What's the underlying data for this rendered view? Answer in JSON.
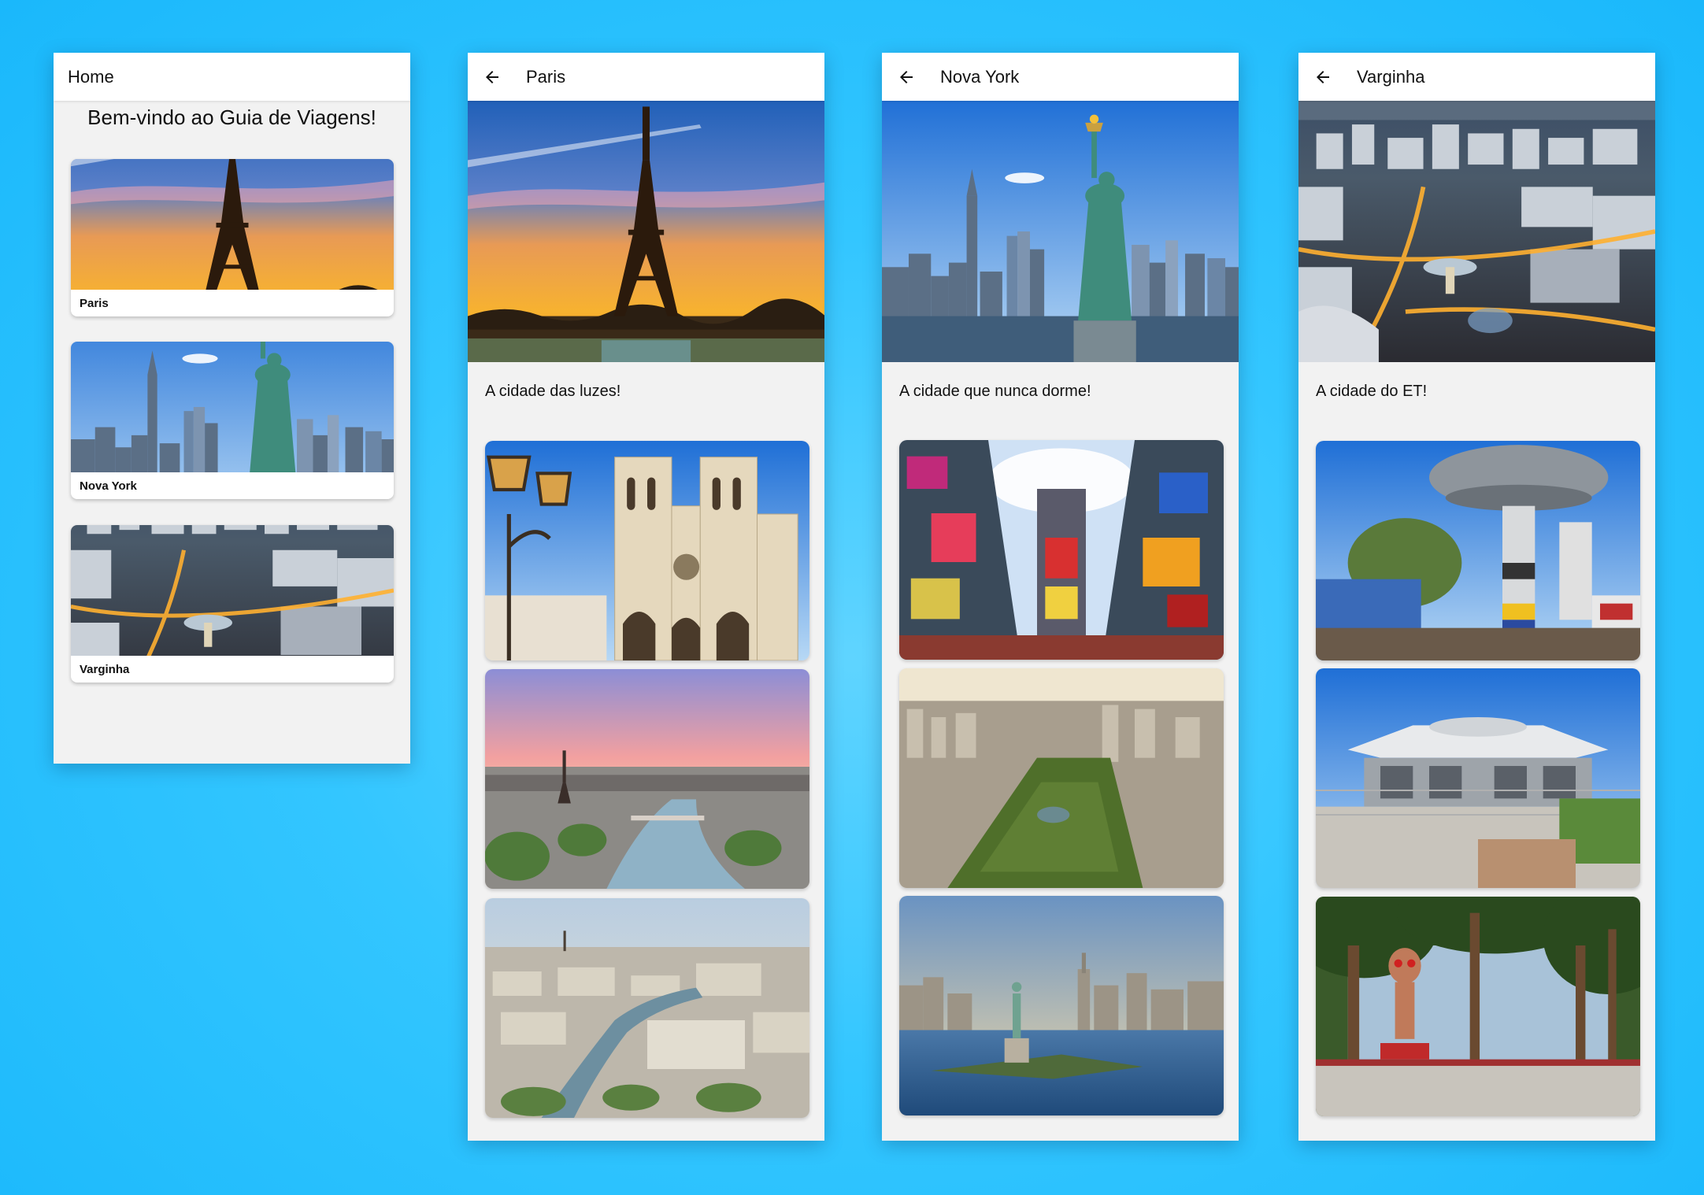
{
  "screens": {
    "home": {
      "title": "Home",
      "welcome": "Bem-vindo ao Guia de Viagens!",
      "cards": [
        {
          "label": "Paris",
          "image": "eiffel-tower-sunset"
        },
        {
          "label": "Nova York",
          "image": "statue-of-liberty-skyline"
        },
        {
          "label": "Varginha",
          "image": "varginha-aerial-night"
        }
      ]
    },
    "paris": {
      "title": "Paris",
      "description": "A cidade das luzes!",
      "hero": "eiffel-tower-sunset",
      "gallery": [
        "notre-dame-cathedral",
        "seine-river-sunset",
        "paris-aerial-view"
      ]
    },
    "nova_york": {
      "title": "Nova York",
      "description": "A cidade que nunca dorme!",
      "hero": "statue-of-liberty-skyline",
      "gallery": [
        "times-square",
        "central-park-aerial",
        "liberty-island-harbor"
      ]
    },
    "varginha": {
      "title": "Varginha",
      "description": "A cidade do ET!",
      "hero": "varginha-aerial-night",
      "gallery": [
        "ufo-water-tower",
        "ufo-shaped-building",
        "alien-statue-park"
      ]
    }
  },
  "icons": {
    "back": "arrow-left-icon"
  },
  "colors": {
    "background": "#1ab8fb",
    "screen": "#f2f2f2",
    "appbar": "#ffffff"
  }
}
